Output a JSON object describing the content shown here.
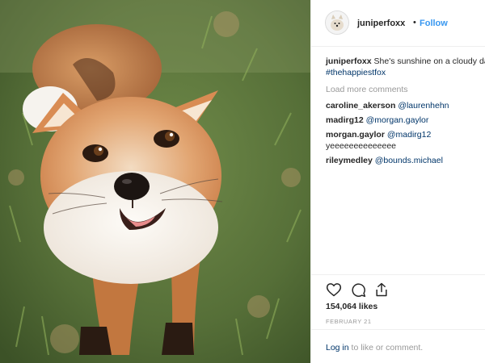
{
  "post": {
    "username": "juniperfoxx",
    "follow_label": "Follow",
    "separator": "•",
    "caption": {
      "user": "juniperfoxx",
      "text": "She's sunshine on a cloudy day",
      "hashtag": "#thehappiestfox"
    },
    "load_more": "Load more comments",
    "comments": [
      {
        "user": "caroline_akerson",
        "mention": "@laurenhehn",
        "text": ""
      },
      {
        "user": "madirg12",
        "mention": "@morgan.gaylor",
        "text": ""
      },
      {
        "user": "morgan.gaylor",
        "mention": "@madirg12",
        "text": "yeeeeeeeeeeeeee"
      },
      {
        "user": "rileymedley",
        "mention": "@bounds.michael",
        "text": ""
      }
    ],
    "likes": "154,064 likes",
    "date": "FEBRUARY 21",
    "login": {
      "link": "Log in",
      "text": "to like or comment."
    },
    "icons": [
      "heart-icon",
      "comment-icon",
      "share-icon"
    ]
  },
  "colors": {
    "link": "#3897f0",
    "mention": "#003569",
    "muted": "#999999",
    "text": "#262626",
    "divider": "#efefef"
  }
}
